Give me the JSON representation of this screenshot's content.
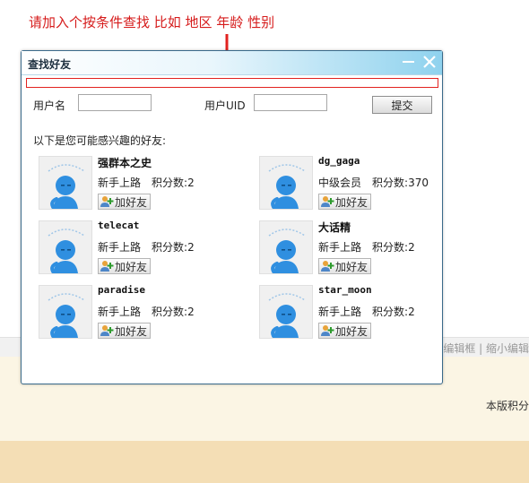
{
  "annotation": "请加入个按条件查找 比如 地区  年龄 性别",
  "background": {
    "bar_links": "编辑框 | 缩小编辑",
    "note": "本版积分"
  },
  "dialog": {
    "title": "查找好友",
    "search": {
      "username_label": "用户名",
      "username_value": "",
      "uid_label": "用户UID",
      "uid_value": "",
      "submit_label": "提交"
    },
    "intro": "以下是您可能感兴趣的好友:",
    "add_label": "加好友",
    "points_prefix": "积分数:",
    "friends": [
      {
        "name": "强群本之史",
        "level": "新手上路",
        "points": "2"
      },
      {
        "name": "dg_gaga",
        "level": "中级会员",
        "points": "370"
      },
      {
        "name": "telecat",
        "level": "新手上路",
        "points": "2"
      },
      {
        "name": "大话精",
        "level": "新手上路",
        "points": "2"
      },
      {
        "name": "paradise",
        "level": "新手上路",
        "points": "2"
      },
      {
        "name": "star_moon",
        "level": "新手上路",
        "points": "2"
      }
    ]
  },
  "colors": {
    "annotation": "#d61c1c",
    "avatar_blue": "#2f8fe0",
    "titlebar_right": "#8fd2ee"
  }
}
